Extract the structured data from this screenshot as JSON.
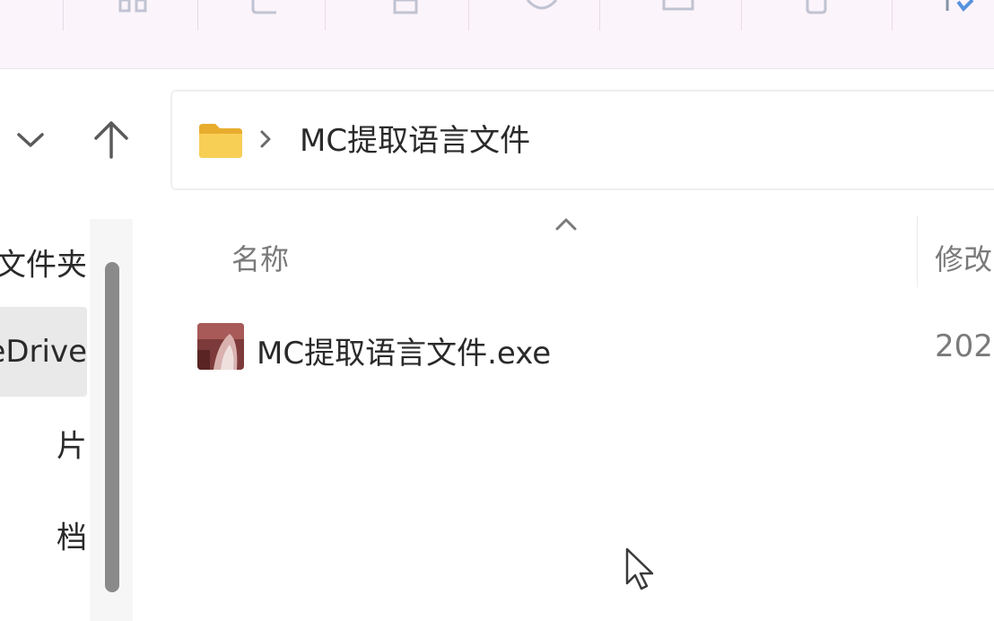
{
  "toolbar": {
    "icons": [
      "view-icon",
      "copy-icon",
      "paste-icon",
      "share-icon",
      "rename-icon",
      "delete-icon",
      "sort-icon"
    ]
  },
  "nav": {
    "recent_icon": "chevron-down-icon",
    "up_icon": "arrow-up-icon"
  },
  "address": {
    "folder_icon": "folder-icon",
    "separator_icon": "chevron-right-icon",
    "path": "MC提取语言文件"
  },
  "sidebar": {
    "items": [
      {
        "label": "文件夹",
        "selected": false
      },
      {
        "label": "eDrive",
        "selected": true
      },
      {
        "label": "片",
        "selected": false
      },
      {
        "label": "档",
        "selected": false
      }
    ]
  },
  "file_list": {
    "columns": {
      "name": "名称",
      "modified": "修改"
    },
    "sort_icon": "sort-ascending-icon",
    "rows": [
      {
        "name": "MC提取语言文件.exe",
        "date": "202",
        "icon": "exe-app-icon"
      }
    ]
  },
  "colors": {
    "toolbar_bg": "#fbf4fb",
    "folder_yellow": "#f6c443",
    "selection_bg": "#e9e9e9"
  }
}
